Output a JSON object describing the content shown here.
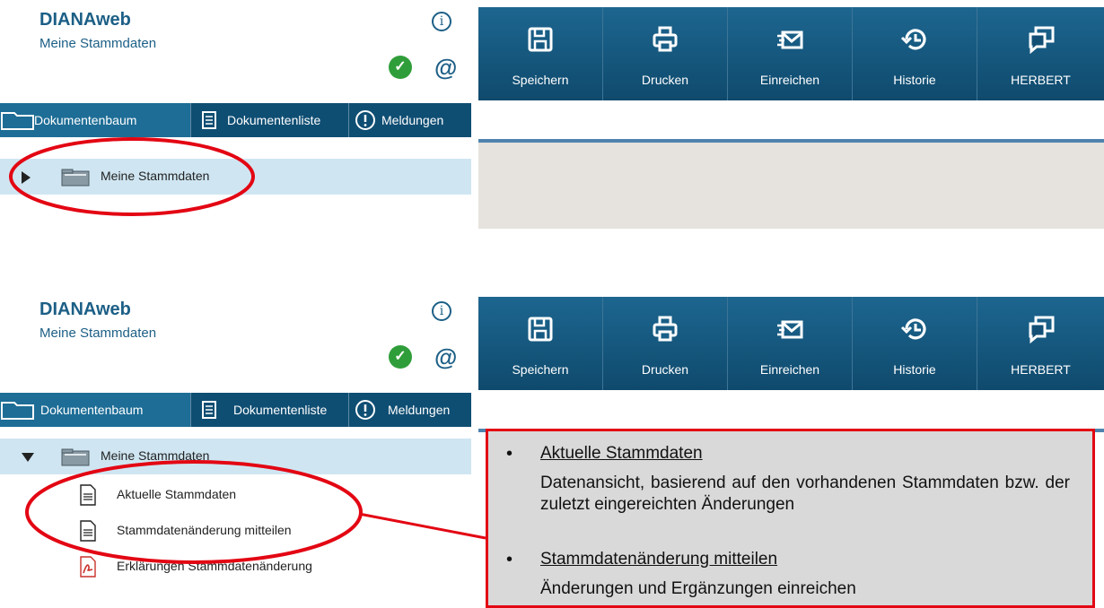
{
  "panels": [
    {
      "app_title": "DIANAweb",
      "app_subtitle": "Meine Stammdaten",
      "tabs": [
        "Dokumentenbaum",
        "Dokumentenliste",
        "Meldungen"
      ],
      "toolbar": [
        "Speichern",
        "Drucken",
        "Einreichen",
        "Historie",
        "HERBERT"
      ],
      "tree_root": "Meine Stammdaten"
    },
    {
      "app_title": "DIANAweb",
      "app_subtitle": "Meine Stammdaten",
      "tabs": [
        "Dokumentenbaum",
        "Dokumentenliste",
        "Meldungen"
      ],
      "toolbar": [
        "Speichern",
        "Drucken",
        "Einreichen",
        "Historie",
        "HERBERT"
      ],
      "tree_root": "Meine Stammdaten",
      "tree_children": [
        "Aktuelle Stammdaten",
        "Stammdatenänderung mitteilen",
        "Erklärungen Stammdatenänderung"
      ]
    }
  ],
  "callout": {
    "item1_title": "Aktuelle Stammdaten",
    "item1_text": "Datenansicht, basierend auf den vorhandenen Stammdaten bzw. der zuletzt eingereichten Änderungen",
    "item2_title": "Stammdatenänderung mitteilen",
    "item2_text": "Änderungen und Ergänzungen einreichen"
  },
  "colors": {
    "brand": "#1c5f86",
    "highlight": "#e30613",
    "tab_bar": "#0f4e73",
    "tree_highlight": "#cfe6f2"
  },
  "icons": [
    "info-icon",
    "check-icon",
    "at-icon",
    "folder-icon",
    "list-icon",
    "alert-icon",
    "save-icon",
    "print-icon",
    "submit-icon",
    "history-icon",
    "chat-icon",
    "document-icon",
    "pdf-icon"
  ]
}
